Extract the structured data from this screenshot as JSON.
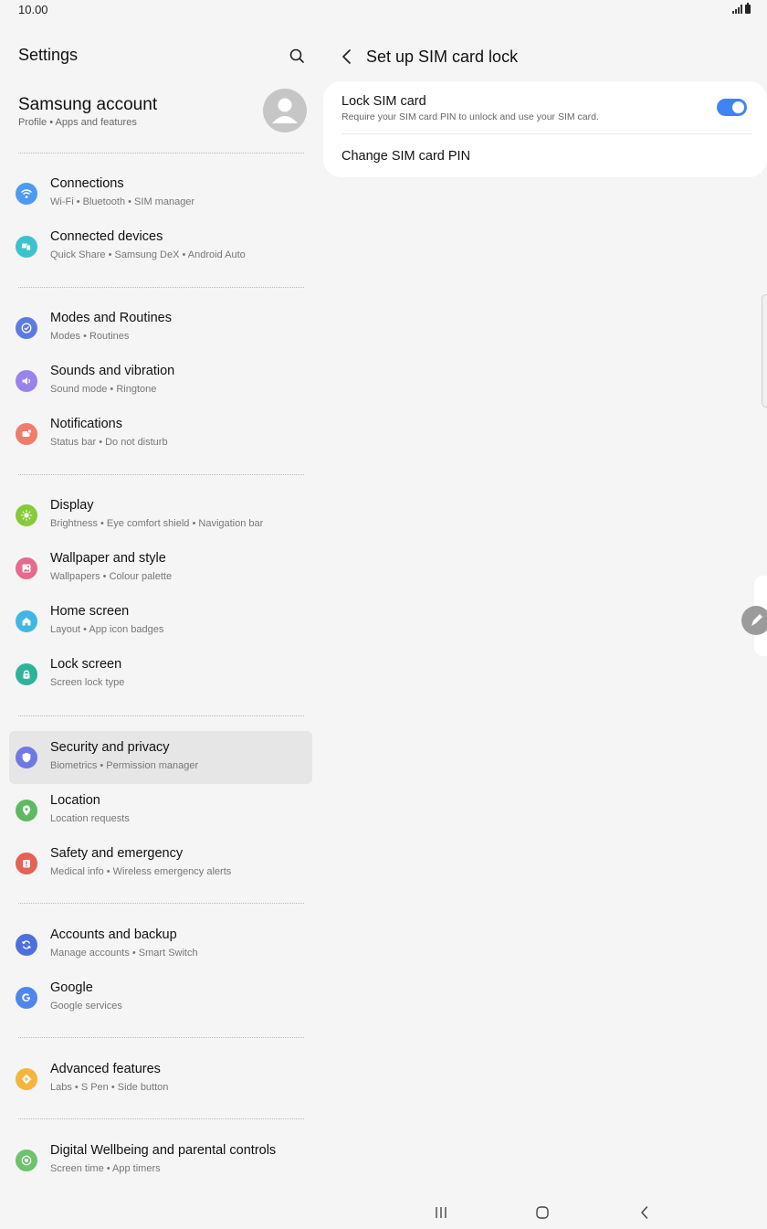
{
  "status_bar": {
    "time": "10.00"
  },
  "left_panel": {
    "title": "Settings",
    "account": {
      "title": "Samsung account",
      "subtitle": "Profile  •  Apps and features"
    },
    "items": [
      {
        "label": "Connections",
        "subtitle": "Wi-Fi  •  Bluetooth  •  SIM manager",
        "icon": "wifi-icon",
        "color": "#4e9af2"
      },
      {
        "label": "Connected devices",
        "subtitle": "Quick Share  •  Samsung DeX  •  Android Auto",
        "icon": "connected-devices-icon",
        "color": "#3ec1cf"
      },
      {
        "label": "Modes and Routines",
        "subtitle": "Modes  •  Routines",
        "icon": "check-circle-icon",
        "color": "#5b7be0"
      },
      {
        "label": "Sounds and vibration",
        "subtitle": "Sound mode  •  Ringtone",
        "icon": "speaker-icon",
        "color": "#9a82ec"
      },
      {
        "label": "Notifications",
        "subtitle": "Status bar  •  Do not disturb",
        "icon": "notification-icon",
        "color": "#f07c6c"
      },
      {
        "label": "Display",
        "subtitle": "Brightness  •  Eye comfort shield  •  Navigation bar",
        "icon": "sun-icon",
        "color": "#86c93a"
      },
      {
        "label": "Wallpaper and style",
        "subtitle": "Wallpapers  •  Colour palette",
        "icon": "image-icon",
        "color": "#e6698e"
      },
      {
        "label": "Home screen",
        "subtitle": "Layout  •  App icon badges",
        "icon": "home-icon",
        "color": "#40b7e2"
      },
      {
        "label": "Lock screen",
        "subtitle": "Screen lock type",
        "icon": "lock-icon",
        "color": "#2eb39a"
      },
      {
        "label": "Security and privacy",
        "subtitle": "Biometrics  •  Permission manager",
        "icon": "shield-icon",
        "color": "#6f78e3"
      },
      {
        "label": "Location",
        "subtitle": "Location requests",
        "icon": "location-pin-icon",
        "color": "#5dba63"
      },
      {
        "label": "Safety and emergency",
        "subtitle": "Medical info  •  Wireless emergency alerts",
        "icon": "alert-icon",
        "color": "#e36155"
      },
      {
        "label": "Accounts and backup",
        "subtitle": "Manage accounts  •  Smart Switch",
        "icon": "sync-icon",
        "color": "#4d70dc"
      },
      {
        "label": "Google",
        "subtitle": "Google services",
        "icon": "google-icon",
        "color": "#4f86ee"
      },
      {
        "label": "Advanced features",
        "subtitle": "Labs  •  S Pen  •  Side button",
        "icon": "gear-plus-icon",
        "color": "#f6b43d"
      },
      {
        "label": "Digital Wellbeing and parental controls",
        "subtitle": "Screen time  •  App timers",
        "icon": "wellbeing-icon",
        "color": "#6cc36b"
      }
    ]
  },
  "right_panel": {
    "title": "Set up SIM card lock",
    "lock_sim": {
      "label": "Lock SIM card",
      "description": "Require your SIM card PIN to unlock and use your SIM card.",
      "enabled": true
    },
    "change_pin": {
      "label": "Change SIM card PIN"
    }
  },
  "colors": {
    "accent": "#3e84f5",
    "background": "#f5f5f5",
    "card": "#ffffff"
  }
}
